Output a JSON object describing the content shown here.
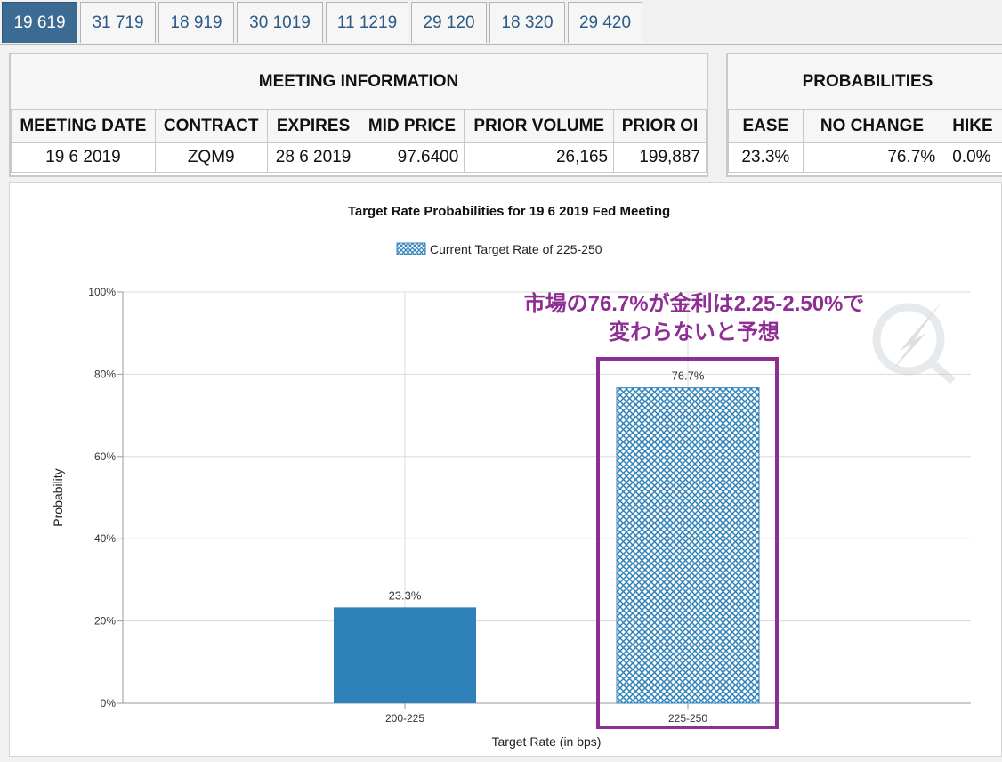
{
  "tabs": [
    {
      "label": "19 619",
      "active": true
    },
    {
      "label": "31 719",
      "active": false
    },
    {
      "label": "18 919",
      "active": false
    },
    {
      "label": "30 1019",
      "active": false
    },
    {
      "label": "11 1219",
      "active": false
    },
    {
      "label": "29 120",
      "active": false
    },
    {
      "label": "18 320",
      "active": false
    },
    {
      "label": "29 420",
      "active": false
    }
  ],
  "meeting_info": {
    "title": "MEETING INFORMATION",
    "headers": [
      "MEETING DATE",
      "CONTRACT",
      "EXPIRES",
      "MID PRICE",
      "PRIOR VOLUME",
      "PRIOR OI"
    ],
    "row": [
      "19 6 2019",
      "ZQM9",
      "28 6 2019",
      "97.6400",
      "26,165",
      "199,887"
    ]
  },
  "probabilities": {
    "title": "PROBABILITIES",
    "headers": [
      "EASE",
      "NO CHANGE",
      "HIKE"
    ],
    "row": [
      "23.3%",
      "76.7%",
      "0.0%"
    ]
  },
  "chart_data": {
    "type": "bar",
    "title": "Target Rate Probabilities for 19 6 2019 Fed Meeting",
    "legend": "Current Target Rate of 225-250",
    "xlabel": "Target Rate (in bps)",
    "ylabel": "Probability",
    "categories": [
      "200-225",
      "225-250"
    ],
    "values": [
      23.3,
      76.7
    ],
    "value_labels": [
      "23.3%",
      "76.7%"
    ],
    "ylim": [
      0,
      100
    ],
    "yticks": [
      "0%",
      "20%",
      "40%",
      "60%",
      "80%",
      "100%"
    ],
    "grid": true,
    "colors": {
      "bar": "#2f82b9",
      "highlight_border": "#8e2e94"
    }
  },
  "annotation": {
    "line1": "市場の76.7%が金利は2.25-2.50%で",
    "line2": "変わらないと予想",
    "color": "#8e2e94"
  }
}
